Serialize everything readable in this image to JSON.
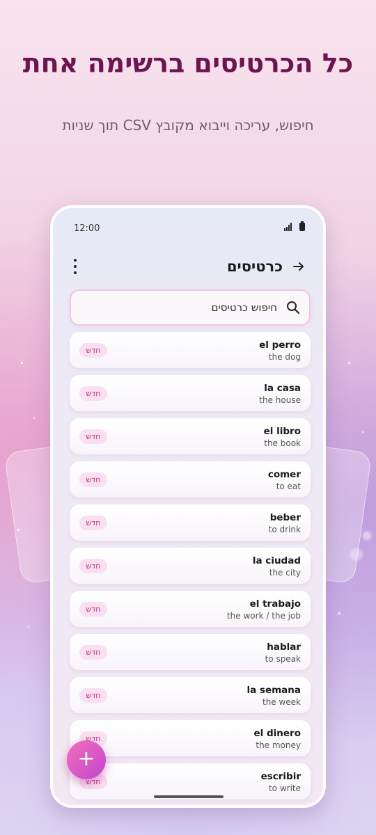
{
  "promo": {
    "headline": "כל הכרטיסים ברשימה אחת",
    "subline": "חיפוש, עריכה וייבוא מקובץ CSV תוך שניות"
  },
  "status_bar": {
    "time": "12:00",
    "icons": [
      "signal-icon",
      "battery-icon"
    ]
  },
  "app_bar": {
    "title": "כרטיסים",
    "back_icon": "arrow-right-icon",
    "menu_icon": "more-vertical-icon"
  },
  "search": {
    "placeholder": "חיפוש כרטיסים",
    "icon": "search-icon"
  },
  "cards": [
    {
      "front": "el perro",
      "back": "the dog",
      "badge": "חדש"
    },
    {
      "front": "la casa",
      "back": "the house",
      "badge": "חדש"
    },
    {
      "front": "el libro",
      "back": "the book",
      "badge": "חדש"
    },
    {
      "front": "comer",
      "back": "to eat",
      "badge": "חדש"
    },
    {
      "front": "beber",
      "back": "to drink",
      "badge": "חדש"
    },
    {
      "front": "la ciudad",
      "back": "the city",
      "badge": "חדש"
    },
    {
      "front": "el trabajo",
      "back": "the work / the job",
      "badge": "חדש"
    },
    {
      "front": "hablar",
      "back": "to speak",
      "badge": "חדש"
    },
    {
      "front": "la semana",
      "back": "the week",
      "badge": "חדש"
    },
    {
      "front": "el dinero",
      "back": "the money",
      "badge": "חדש"
    },
    {
      "front": "escribir",
      "back": "to write",
      "badge": "חדש"
    }
  ],
  "fab": {
    "label": "+",
    "icon": "plus-icon"
  },
  "colors": {
    "accent": "#c0307f",
    "headline": "#6d1550",
    "badge_bg": "#f9dff0",
    "fab_start": "#f36fbc",
    "fab_end": "#c145cf"
  }
}
